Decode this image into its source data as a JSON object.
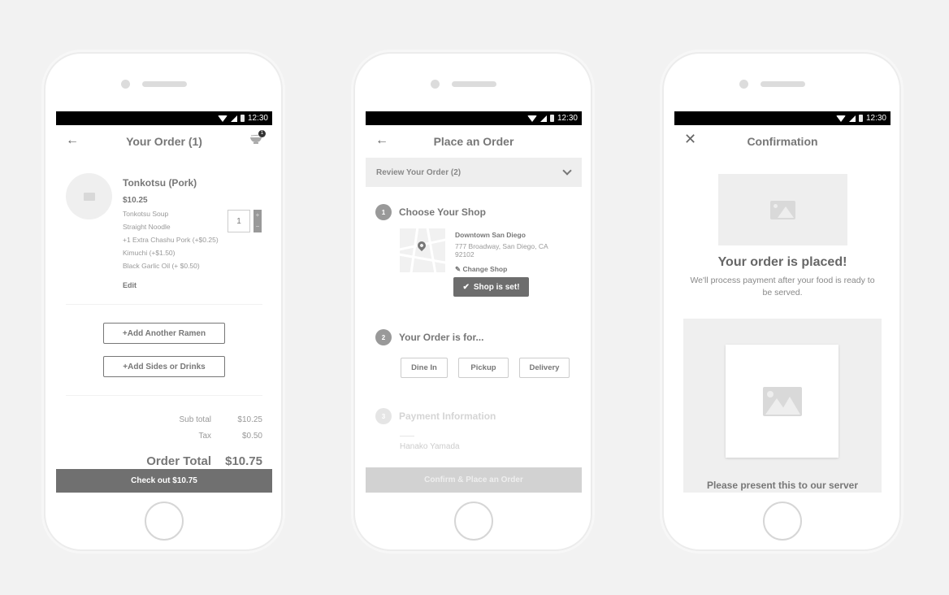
{
  "status_bar": {
    "time": "12:30"
  },
  "screens": [
    {
      "title": "Your Order (1)",
      "cart_badge": "1",
      "item": {
        "name": "Tonkotsu (Pork)",
        "price": "$10.25",
        "options": [
          "Tonkotsu Soup",
          "Straight Noodle",
          "+1 Extra Chashu Pork (+$0.25)",
          "Kimuchi (+$1.50)",
          "Black Garlic Oil (+ $0.50)"
        ],
        "edit_label": "Edit",
        "quantity": "1",
        "plus": "+",
        "minus": "−"
      },
      "add_buttons": [
        "+Add Another Ramen",
        "+Add Sides or Drinks"
      ],
      "totals": {
        "subtotal_label": "Sub total",
        "subtotal": "$10.25",
        "tax_label": "Tax",
        "tax": "$0.50",
        "total_label": "Order Total",
        "total": "$10.75"
      },
      "checkout_label": "Check out $10.75"
    },
    {
      "title": "Place an Order",
      "review_label": "Review Your Order (2)",
      "steps": [
        {
          "num": "1",
          "title": "Choose Your Shop"
        },
        {
          "num": "2",
          "title": "Your Order is for..."
        },
        {
          "num": "3",
          "title": "Payment Information"
        }
      ],
      "shop": {
        "name": "Downtown San Diego",
        "address": "777 Broadway, San Diego, CA 92102",
        "change_label": "Change Shop",
        "set_label": "Shop is set!"
      },
      "order_types": [
        "Dine In",
        "Pickup",
        "Delivery"
      ],
      "payment_name": "Hanako Yamada",
      "confirm_label": "Confirm & Place an Order"
    },
    {
      "title": "Confirmation",
      "placed_title": "Your order is placed!",
      "placed_message": "We'll process payment after your food is ready to be served.",
      "qr_caption": "Please present this to our server"
    }
  ]
}
